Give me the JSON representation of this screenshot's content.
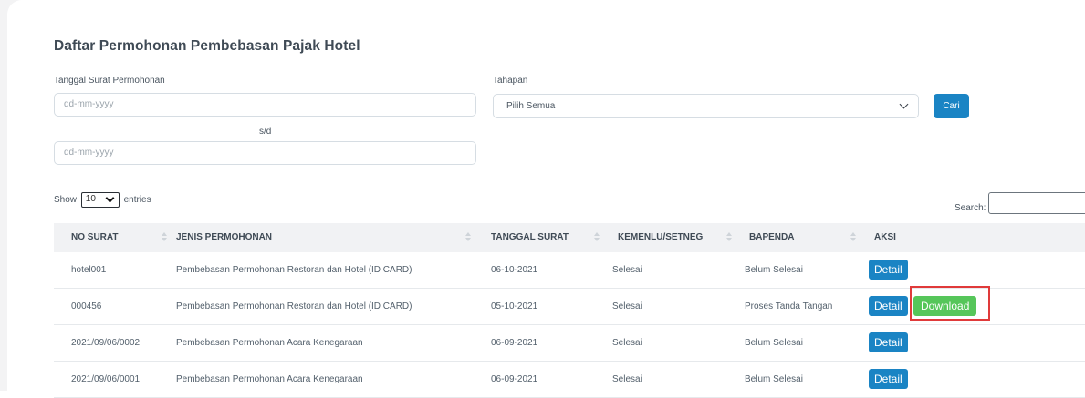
{
  "page": {
    "title": "Daftar Permohonan Pembebasan Pajak Hotel"
  },
  "filters": {
    "date_label": "Tanggal Surat Permohonan",
    "date_from_placeholder": "dd-mm-yyyy",
    "date_separator": "s/d",
    "date_to_placeholder": "dd-mm-yyyy",
    "stage_label": "Tahapan",
    "stage_selected": "Pilih Semua",
    "search_button": "Cari"
  },
  "table_controls": {
    "show_label": "Show",
    "entries_value": "10",
    "entries_label": "entries",
    "search_label": "Search:"
  },
  "table": {
    "columns": [
      "NO SURAT",
      "JENIS PERMOHONAN",
      "TANGGAL SURAT",
      "KEMENLU/SETNEG",
      "BAPENDA",
      "AKSI"
    ],
    "rows": [
      {
        "no_surat": "hotel001",
        "jenis": "Pembebasan Permohonan Restoran dan Hotel (ID CARD)",
        "tanggal": "06-10-2021",
        "kemenlu": "Selesai",
        "bapenda": "Belum Selesai",
        "actions": [
          "Detail"
        ]
      },
      {
        "no_surat": "000456",
        "jenis": "Pembebasan Permohonan Restoran dan Hotel (ID CARD)",
        "tanggal": "05-10-2021",
        "kemenlu": "Selesai",
        "bapenda": "Proses Tanda Tangan",
        "actions": [
          "Detail",
          "Download"
        ]
      },
      {
        "no_surat": "2021/09/06/0002",
        "jenis": "Pembebasan Permohonan Acara Kenegaraan",
        "tanggal": "06-09-2021",
        "kemenlu": "Selesai",
        "bapenda": "Belum Selesai",
        "actions": [
          "Detail"
        ]
      },
      {
        "no_surat": "2021/09/06/0001",
        "jenis": "Pembebasan Permohonan Acara Kenegaraan",
        "tanggal": "06-09-2021",
        "kemenlu": "Selesai",
        "bapenda": "Belum Selesai",
        "actions": [
          "Detail"
        ]
      }
    ]
  },
  "colors": {
    "primary": "#1a84c4",
    "success": "#56c65a",
    "highlight": "#e03a3a",
    "header_bg": "#f1f2f4"
  }
}
